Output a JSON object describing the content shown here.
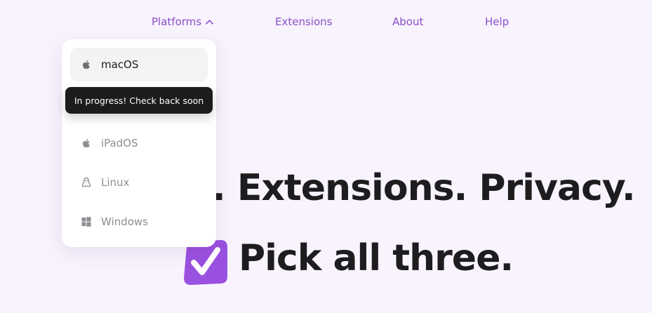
{
  "nav": {
    "platforms_label": "Platforms",
    "extensions_label": "Extensions",
    "about_label": "About",
    "help_label": "Help"
  },
  "dropdown": {
    "items": [
      {
        "label": "macOS",
        "icon": "apple-icon",
        "active": true
      },
      {
        "label": "iPadOS",
        "icon": "apple-icon",
        "active": false
      },
      {
        "label": "Linux",
        "icon": "linux-penguin-icon",
        "active": false
      },
      {
        "label": "Windows",
        "icon": "windows-icon",
        "active": false
      }
    ],
    "tooltip": "In progress! Check back soon"
  },
  "hero": {
    "line1": ". Extensions. Privacy.",
    "line2": "Pick all three."
  },
  "colors": {
    "background": "#f8f3fd",
    "accent": "#8b4ec9",
    "badge": "#9b51e0",
    "text": "#1d1d1f",
    "tooltip_bg": "#1c1c1e"
  }
}
